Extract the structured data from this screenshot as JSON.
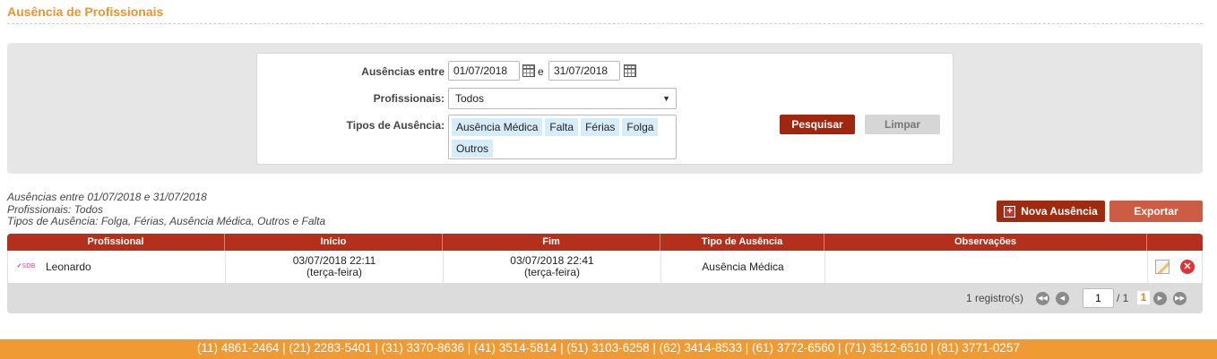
{
  "page": {
    "title": "Ausência de Profissionais"
  },
  "filters": {
    "date_label": "Ausências entre",
    "date_from": "01/07/2018",
    "date_conj": "e",
    "date_to": "31/07/2018",
    "professional_label": "Profissionais:",
    "professional_value": "Todos",
    "types_label": "Tipos de Ausência:",
    "types": [
      "Ausência Médica",
      "Falta",
      "Férias",
      "Folga",
      "Outros"
    ],
    "search_label": "Pesquisar",
    "clear_label": "Limpar"
  },
  "summary": {
    "line1": "Ausências entre 01/07/2018 e 31/07/2018",
    "line2": "Profissionais: Todos",
    "line3": "Tipos de Ausência: Folga, Férias, Ausência Médica, Outros e Falta"
  },
  "actions": {
    "new_label": "Nova Ausência",
    "export_label": "Exportar"
  },
  "table": {
    "columns": [
      "Profissional",
      "Início",
      "Fim",
      "Tipo de Ausência",
      "Observações",
      ""
    ],
    "rows": [
      {
        "logo": "SDB",
        "professional": "Leonardo",
        "start_date": "03/07/2018 22:11",
        "start_day": "(terça-feira)",
        "end_date": "03/07/2018 22:41",
        "end_day": "(terça-feira)",
        "type": "Ausência Médica",
        "notes": ""
      }
    ]
  },
  "pagination": {
    "records": "1 registro(s)",
    "page": "1",
    "total": "/ 1",
    "current_link": "1"
  },
  "footer": {
    "phones": "(11) 4861-2464 | (21) 2283-5401 | (31) 3370-8636 | (41) 3514-5814 | (51) 3103-6258 | (62) 3414-8533 | (61) 3772-6560 | (71) 3512-6510 | (81) 3771-0257"
  },
  "colors": {
    "accent": "#f0932b",
    "primary_red": "#a0270f",
    "header_red": "#b5301a",
    "footer_orange": "#ef9a33"
  }
}
